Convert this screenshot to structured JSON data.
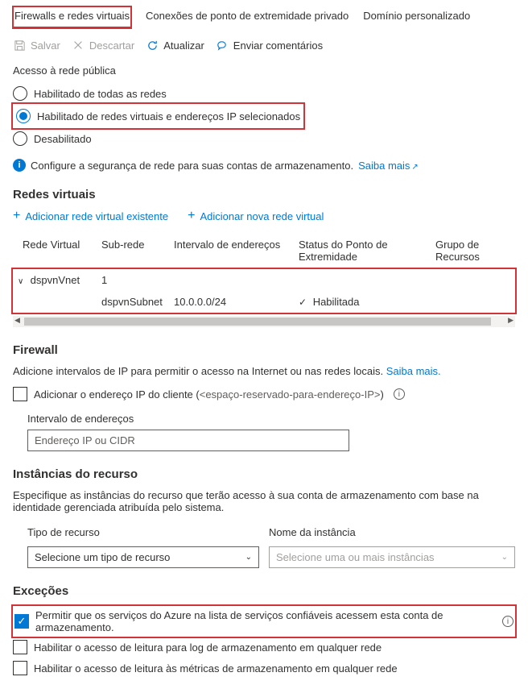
{
  "tabs": {
    "firewalls": "Firewalls e redes virtuais",
    "private_endpoint": "Conexões de ponto de extremidade privado",
    "custom_domain": "Domínio personalizado"
  },
  "toolbar": {
    "save": "Salvar",
    "discard": "Descartar",
    "refresh": "Atualizar",
    "feedback": "Enviar comentários"
  },
  "public_access": {
    "label": "Acesso à rede pública",
    "opt_all": "Habilitado de todas as redes",
    "opt_selected": "Habilitado de redes virtuais e endereços IP selecionados",
    "opt_disabled": "Desabilitado",
    "info_text": "Configure a segurança de rede para suas contas de armazenamento.",
    "learn_more": "Saiba mais"
  },
  "vnets": {
    "header": "Redes virtuais",
    "add_existing": "Adicionar rede virtual existente",
    "add_new": "Adicionar nova rede virtual",
    "col_vnet": "Rede Virtual",
    "col_subnet": "Sub-rede",
    "col_range": "Intervalo de endereços",
    "col_status": "Status do Ponto de Extremidade",
    "col_rg": "Grupo de Recursos",
    "row_vnet_name": "dspvnVnet",
    "row_vnet_count": "1",
    "row_subnet_name": "dspvnSubnet",
    "row_subnet_range": "10.0.0.0/24",
    "row_subnet_status": "Habilitada"
  },
  "firewall": {
    "header": "Firewall",
    "desc_prefix": "Adicione intervalos de IP para permitir o acesso na Internet ou nas redes locais.",
    "learn_more": "Saiba mais.",
    "add_client_ip_prefix": "Adicionar o endereço IP do cliente (",
    "add_client_ip_placeholder": "<espaço-reservado-para-endereço-IP>",
    "add_client_ip_suffix": ")",
    "range_label": "Intervalo de endereços",
    "range_placeholder": "Endereço IP ou CIDR"
  },
  "resource_instances": {
    "header": "Instâncias do recurso",
    "desc": "Especifique as instâncias do recurso que terão acesso à sua conta de armazenamento com base na identidade gerenciada atribuída pelo sistema.",
    "type_label": "Tipo de recurso",
    "name_label": "Nome da instância",
    "type_placeholder": "Selecione um tipo de recurso",
    "name_placeholder": "Selecione uma ou mais instâncias"
  },
  "exceptions": {
    "header": "Exceções",
    "trusted_services": "Permitir que os serviços do Azure na lista de serviços confiáveis acessem esta conta de armazenamento.",
    "read_log": "Habilitar o acesso de leitura para log de armazenamento em qualquer rede",
    "read_metrics": "Habilitar o acesso de leitura às métricas de armazenamento em qualquer rede"
  }
}
